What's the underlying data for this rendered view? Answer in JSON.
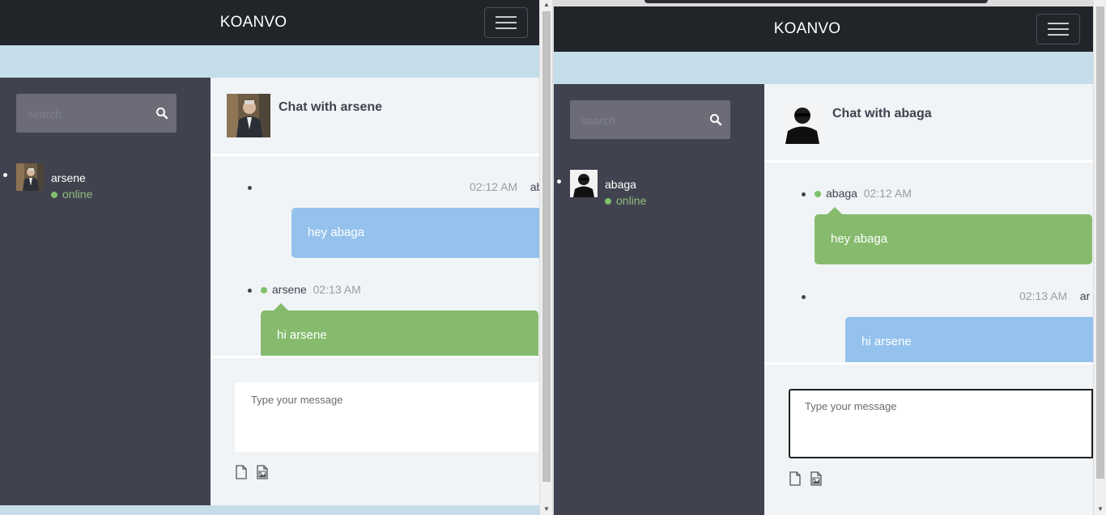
{
  "brand": "KOANVO",
  "search": {
    "placeholder": "search"
  },
  "composer": {
    "placeholder": "Type your message"
  },
  "left": {
    "contact": {
      "name": "arsene",
      "status": "online"
    },
    "chat_title": "Chat with arsene",
    "messages": [
      {
        "sender": "ab",
        "time": "02:12 AM",
        "text": "hey abaga",
        "side": "sent"
      },
      {
        "sender": "arsene",
        "time": "02:13 AM",
        "text": "hi arsene",
        "side": "received"
      }
    ]
  },
  "right": {
    "contact": {
      "name": "abaga",
      "status": "online"
    },
    "chat_title": "Chat with abaga",
    "messages": [
      {
        "sender": "abaga",
        "time": "02:12 AM",
        "text": "hey abaga",
        "side": "received"
      },
      {
        "sender": "ar",
        "time": "02:13 AM",
        "text": "hi arsene",
        "side": "sent"
      }
    ]
  },
  "colors": {
    "navbar": "#212429",
    "sidebar": "#41424f",
    "sent_bubble": "#94c2ec",
    "received_bubble": "#86bb6e",
    "online_dot": "#7fbf6b",
    "page_background": "#c5dde9"
  }
}
